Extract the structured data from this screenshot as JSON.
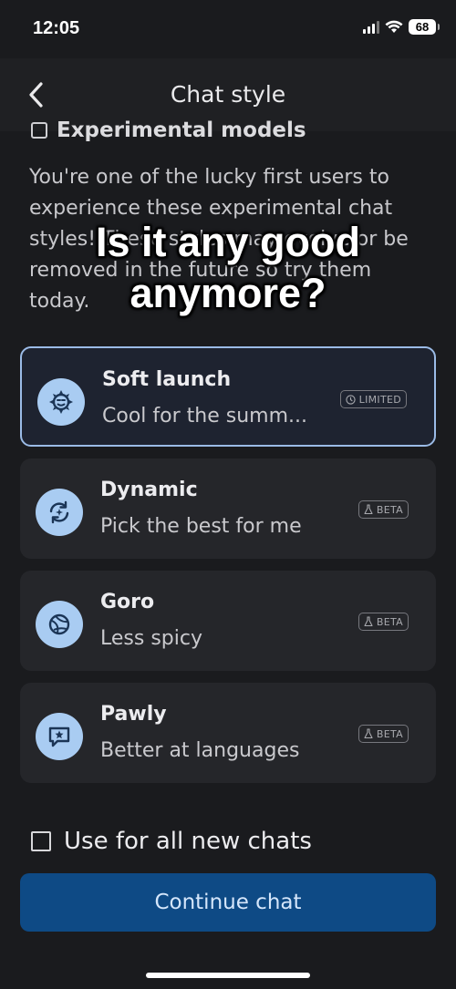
{
  "status_bar": {
    "time": "12:05",
    "battery": "68"
  },
  "header": {
    "title": "Chat style",
    "back_icon": "chevron-left-icon"
  },
  "section": {
    "heading": "Experimental models",
    "description": "You're one of the lucky first users to experience these experimental chat styles! These styles may evolve or be removed in the future so try them today."
  },
  "overlay_caption": "Is it any good anymore?",
  "styles": [
    {
      "name": "Soft launch",
      "subtitle": "Cool for the summ...",
      "badge": "LIMITED",
      "icon": "sun-face-icon",
      "selected": true
    },
    {
      "name": "Dynamic",
      "subtitle": "Pick the best for me",
      "badge": "BETA",
      "icon": "refresh-sparkle-icon",
      "selected": false
    },
    {
      "name": "Goro",
      "subtitle": "Less spicy",
      "badge": "BETA",
      "icon": "globe-swirl-icon",
      "selected": false
    },
    {
      "name": "Pawly",
      "subtitle": "Better at languages",
      "badge": "BETA",
      "icon": "chat-star-icon",
      "selected": false
    }
  ],
  "options": {
    "use_for_all_label": "Use for all new chats",
    "use_for_all_checked": false
  },
  "actions": {
    "continue_label": "Continue chat"
  },
  "colors": {
    "background": "#1a1b1e",
    "card": "#25262a",
    "selected_border": "#9bbbe6",
    "icon_circle": "#a9ccf2",
    "primary_button": "#0e4a85"
  }
}
